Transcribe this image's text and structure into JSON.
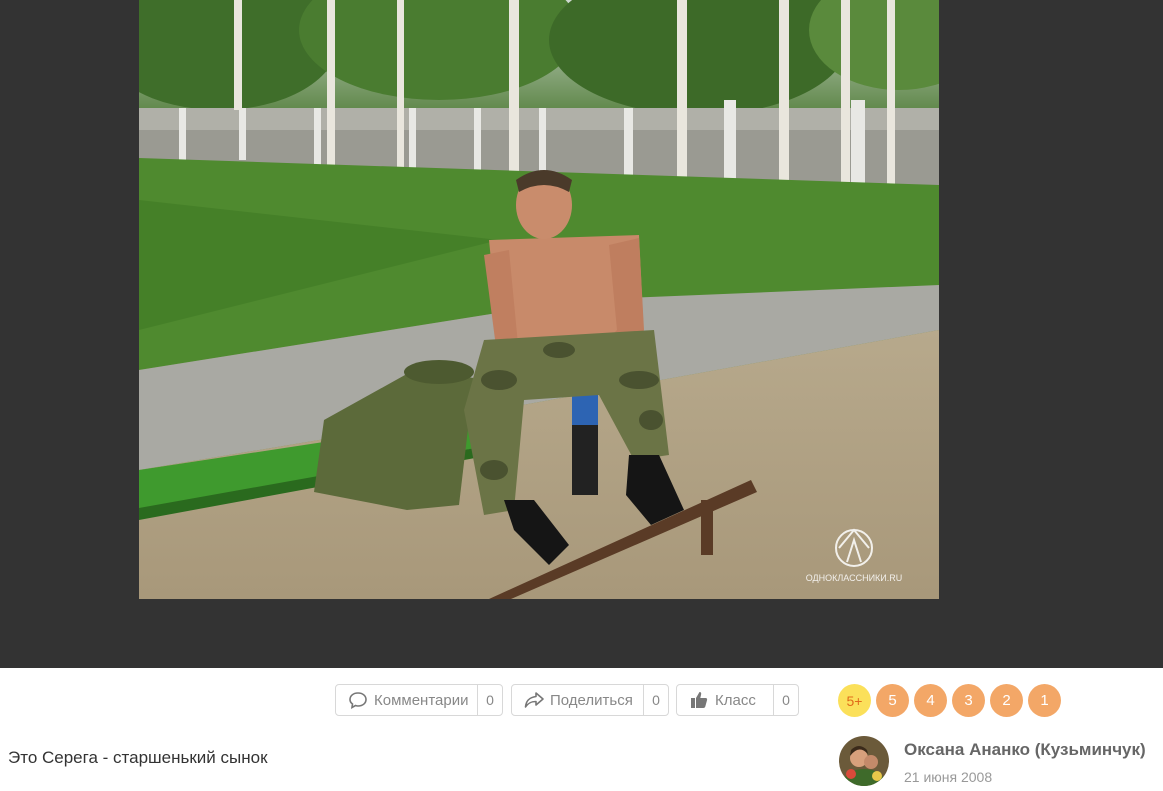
{
  "photo": {
    "alt": "",
    "watermark": "ОДНОКЛАССНИКИ.RU"
  },
  "actions": {
    "comments": {
      "label": "Комментарии",
      "count": "0",
      "icon": "comment-icon"
    },
    "share": {
      "label": "Поделиться",
      "count": "0",
      "icon": "share-icon"
    },
    "like": {
      "label": "Класс",
      "count": "0",
      "icon": "thumbs-up-icon"
    }
  },
  "ratings": [
    "5+",
    "5",
    "4",
    "3",
    "2",
    "1"
  ],
  "caption": "Это Серега - старшенький сынок",
  "author": {
    "name": "Оксана Ананко (Кузьминчук)",
    "date": "21 июня 2008"
  },
  "colors": {
    "viewer_bg": "#333333",
    "rating_orange": "#f3a767",
    "rating_plus": "#fbe05a"
  }
}
